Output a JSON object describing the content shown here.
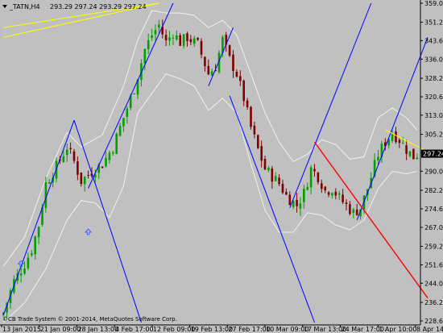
{
  "header": {
    "symbol_tf": "_TATN,H4",
    "ohlc": "293.29 297.24 293.29 297.24"
  },
  "footer": {
    "copyright": "©CB Trade System © 2001-2014, MetaQuotes Software Corp."
  },
  "current_price": "297.24",
  "colors": {
    "background": "#c0c0c0",
    "bull": "#00a000",
    "bear": "#800000",
    "bands": "#f0f0f0",
    "trend_blue": "#0000ff",
    "trend_red": "#ff0000",
    "trend_yellow": "#ffff00",
    "price_badge": "#000000"
  },
  "chart_data": {
    "type": "candlestick",
    "y_ticks": [
      "359.00",
      "351.20",
      "343.65",
      "336.05",
      "328.20",
      "320.60",
      "313.05",
      "305.20",
      "297.65",
      "290.05",
      "282.20",
      "274.60",
      "267.00",
      "259.20",
      "251.60",
      "244.05",
      "236.20",
      "228.60"
    ],
    "ylim": [
      228.6,
      359.0
    ],
    "x_ticks": [
      "13 Jan 2015",
      "21 Jan 09:00",
      "28 Jan 13:00",
      "4 Feb 17:00",
      "12 Feb 09:00",
      "19 Feb 13:00",
      "27 Feb 17:00",
      "10 Mar 09:00",
      "17 Mar 13:00",
      "24 Mar 17:00",
      "1 Apr 10:00",
      "8 Apr 14:00"
    ],
    "close_anchors": [
      [
        0,
        232
      ],
      [
        3,
        245
      ],
      [
        6,
        252
      ],
      [
        8,
        258
      ],
      [
        10,
        268
      ],
      [
        12,
        285
      ],
      [
        15,
        292
      ],
      [
        18,
        300
      ],
      [
        20,
        294
      ],
      [
        22,
        286
      ],
      [
        25,
        290
      ],
      [
        28,
        293
      ],
      [
        31,
        300
      ],
      [
        34,
        312
      ],
      [
        37,
        324
      ],
      [
        40,
        340
      ],
      [
        42,
        346
      ],
      [
        44,
        350
      ],
      [
        46,
        343
      ],
      [
        48,
        347
      ],
      [
        50,
        343
      ],
      [
        52,
        345
      ],
      [
        55,
        342
      ],
      [
        58,
        330
      ],
      [
        60,
        333
      ],
      [
        62,
        344
      ],
      [
        64,
        336
      ],
      [
        66,
        330
      ],
      [
        68,
        320
      ],
      [
        70,
        308
      ],
      [
        72,
        299
      ],
      [
        74,
        291
      ],
      [
        76,
        288
      ],
      [
        78,
        285
      ],
      [
        80,
        280
      ],
      [
        83,
        276
      ],
      [
        85,
        281
      ],
      [
        87,
        291
      ],
      [
        89,
        288
      ],
      [
        91,
        282
      ],
      [
        93,
        283
      ],
      [
        95,
        279
      ],
      [
        97,
        276
      ],
      [
        99,
        273
      ],
      [
        101,
        275
      ],
      [
        103,
        283
      ],
      [
        106,
        297
      ],
      [
        108,
        302
      ],
      [
        110,
        306
      ],
      [
        112,
        303
      ],
      [
        114,
        299
      ],
      [
        116,
        296
      ],
      [
        117,
        297
      ]
    ],
    "upper_band_anchors": [
      [
        0,
        251
      ],
      [
        6,
        263
      ],
      [
        12,
        287
      ],
      [
        18,
        306
      ],
      [
        22,
        300
      ],
      [
        28,
        305
      ],
      [
        34,
        325
      ],
      [
        38,
        344
      ],
      [
        42,
        356
      ],
      [
        46,
        355
      ],
      [
        50,
        355
      ],
      [
        54,
        354
      ],
      [
        58,
        349
      ],
      [
        62,
        352
      ],
      [
        66,
        346
      ],
      [
        70,
        330
      ],
      [
        74,
        314
      ],
      [
        78,
        302
      ],
      [
        82,
        294
      ],
      [
        86,
        297
      ],
      [
        90,
        303
      ],
      [
        94,
        301
      ],
      [
        98,
        295
      ],
      [
        102,
        296
      ],
      [
        106,
        312
      ],
      [
        110,
        316
      ],
      [
        114,
        312
      ],
      [
        117,
        307
      ]
    ],
    "lower_band_anchors": [
      [
        0,
        228
      ],
      [
        6,
        236
      ],
      [
        12,
        250
      ],
      [
        18,
        270
      ],
      [
        22,
        278
      ],
      [
        26,
        277
      ],
      [
        30,
        271
      ],
      [
        34,
        284
      ],
      [
        38,
        314
      ],
      [
        42,
        322
      ],
      [
        46,
        330
      ],
      [
        50,
        328
      ],
      [
        54,
        325
      ],
      [
        58,
        315
      ],
      [
        62,
        320
      ],
      [
        66,
        314
      ],
      [
        70,
        293
      ],
      [
        74,
        274
      ],
      [
        78,
        265
      ],
      [
        82,
        265
      ],
      [
        86,
        273
      ],
      [
        90,
        272
      ],
      [
        94,
        268
      ],
      [
        98,
        266
      ],
      [
        102,
        270
      ],
      [
        106,
        283
      ],
      [
        110,
        290
      ],
      [
        114,
        289
      ],
      [
        117,
        290
      ]
    ],
    "trendlines": [
      {
        "color": "yellow",
        "from": [
          0,
          349
        ],
        "to": [
          44,
          359
        ]
      },
      {
        "color": "yellow",
        "from": [
          0,
          345
        ],
        "to": [
          44,
          359
        ]
      },
      {
        "color": "blue",
        "from": [
          0,
          231
        ],
        "to": [
          20,
          311
        ]
      },
      {
        "color": "blue",
        "from": [
          20,
          311
        ],
        "to": [
          39,
          228
        ]
      },
      {
        "color": "blue",
        "from": [
          24,
          283
        ],
        "to": [
          48,
          359
        ]
      },
      {
        "color": "blue",
        "from": [
          64,
          321
        ],
        "to": [
          88,
          228
        ]
      },
      {
        "color": "blue",
        "from": [
          58,
          325
        ],
        "to": [
          65,
          349
        ]
      },
      {
        "color": "blue",
        "from": [
          81,
          275
        ],
        "to": [
          104,
          359
        ]
      },
      {
        "color": "blue",
        "from": [
          100,
          270
        ],
        "to": [
          120,
          345
        ]
      },
      {
        "color": "red",
        "from": [
          88,
          302
        ],
        "to": [
          120,
          238
        ]
      },
      {
        "color": "yellow",
        "from": [
          108,
          307
        ],
        "to": [
          120,
          298
        ]
      }
    ],
    "arrow_markers": [
      [
        5,
        252
      ],
      [
        24,
        265
      ]
    ]
  }
}
